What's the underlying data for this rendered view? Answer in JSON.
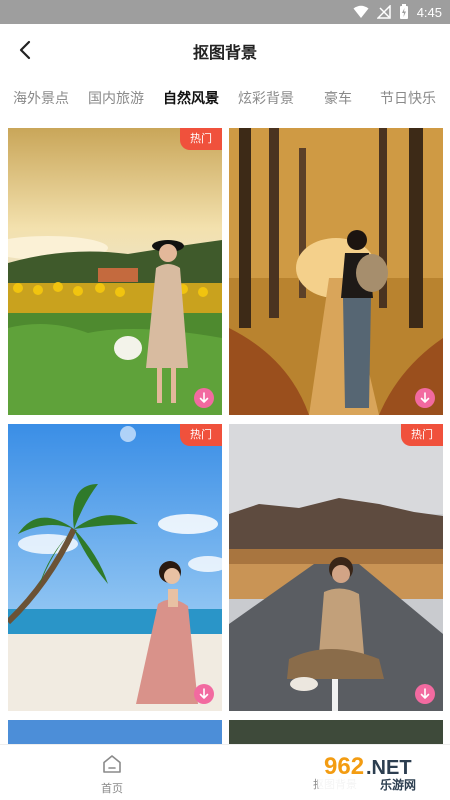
{
  "status_bar": {
    "time": "4:45"
  },
  "header": {
    "title": "抠图背景"
  },
  "tabs": [
    {
      "label": "海外景点"
    },
    {
      "label": "国内旅游"
    },
    {
      "label": "自然风景"
    },
    {
      "label": "炫彩背景"
    },
    {
      "label": "豪车"
    },
    {
      "label": "节日快乐"
    }
  ],
  "active_tab_index": 2,
  "cards": [
    {
      "badge": "热门",
      "scene": "sunflower-field-woman"
    },
    {
      "badge": "",
      "scene": "autumn-forest-path-woman"
    },
    {
      "badge": "热门",
      "scene": "palm-beach-woman"
    },
    {
      "badge": "热门",
      "scene": "mountain-road-woman"
    }
  ],
  "bottom_nav": {
    "home_label": "首页",
    "matting_label": "抠图背景"
  },
  "watermark": {
    "brand": "962",
    "suffix": ".NET",
    "sub": "乐游网"
  },
  "colors": {
    "accent": "#f0513c",
    "download": "#f26aa0",
    "status_bar": "#9e9e9e"
  }
}
